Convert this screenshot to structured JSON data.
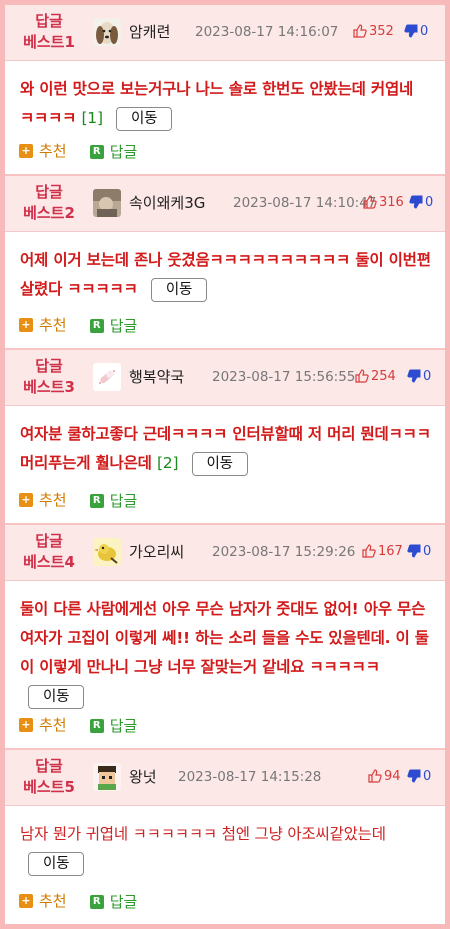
{
  "posts": [
    {
      "rank": [
        "답글",
        "베스트1"
      ],
      "avatar": "dog-avatar",
      "nickname": "암캐련",
      "date": "2023-08-17 14:16:07",
      "likes": "352",
      "dislikes": "0",
      "text": "와 이런 맛으로 보는거구나 나느 솔로 한번도 안봤는데 커엽네 ㅋㅋㅋㅋ",
      "reply_count": "[1]",
      "move_label": "이동",
      "recommend_label": "추천",
      "reply_label": "답글"
    },
    {
      "rank": [
        "답글",
        "베스트2"
      ],
      "avatar": "photo-avatar",
      "nickname": "속이왜케3G",
      "date": "2023-08-17 14:10:47",
      "likes": "316",
      "dislikes": "0",
      "text": "어제 이거 보는데 존나 웃겼음ㅋㅋㅋㅋㅋㅋㅋㅋㅋㅋ 둘이 이번편 살렸다 ㅋㅋㅋㅋㅋ",
      "reply_count": "",
      "move_label": "이동",
      "recommend_label": "추천",
      "reply_label": "답글"
    },
    {
      "rank": [
        "답글",
        "베스트3"
      ],
      "avatar": "pill-avatar",
      "nickname": "행복약국",
      "date": "2023-08-17 15:56:55",
      "likes": "254",
      "dislikes": "0",
      "text": "여자분 쿨하고좋다 근데ㅋㅋㅋㅋ 인터뷰할때 저 머리 뭔데ㅋㅋㅋ 머리푸는게 훨나은데",
      "reply_count": "[2]",
      "move_label": "이동",
      "recommend_label": "추천",
      "reply_label": "답글"
    },
    {
      "rank": [
        "답글",
        "베스트4"
      ],
      "avatar": "bird-avatar",
      "nickname": "가오리씨",
      "date": "2023-08-17 15:29:26",
      "likes": "167",
      "dislikes": "0",
      "text": "둘이 다른 사람에게선 아우 무슨 남자가 줏대도 없어! 아우 무슨 여자가 고집이 이렇게 쎄!! 하는 소리 들을 수도 있을텐데. 이 둘이 이렇게 만나니 그냥 너무 잘맞는거 같네요 ㅋㅋㅋㅋㅋ",
      "reply_count": "",
      "move_label": "이동",
      "recommend_label": "추천",
      "reply_label": "답글"
    },
    {
      "rank": [
        "답글",
        "베스트5"
      ],
      "avatar": "pixel-avatar",
      "nickname": "왕넛",
      "date": "2023-08-17 14:15:28",
      "likes": "94",
      "dislikes": "0",
      "text": "남자 뭔가 귀엽네 ㅋㅋㅋㅋㅋㅋ 첨엔 그냥 아조씨같았는데",
      "reply_count": "",
      "move_label": "이동",
      "recommend_label": "추천",
      "reply_label": "답글"
    }
  ],
  "icons": {
    "thumb_up": "thumbs-up-icon",
    "thumb_down": "thumbs-down-icon",
    "recommend": "plus-icon",
    "reply": "reply-r-icon"
  },
  "colors": {
    "rank": "#d0314a",
    "body_text": "#d21a1a",
    "likes": "#d93a3a",
    "dislikes": "#2d4bd1",
    "recommend": "#d07b00",
    "reply": "#2f9a30",
    "header_bg": "#fde8e8",
    "frame": "#f7b9b9"
  }
}
